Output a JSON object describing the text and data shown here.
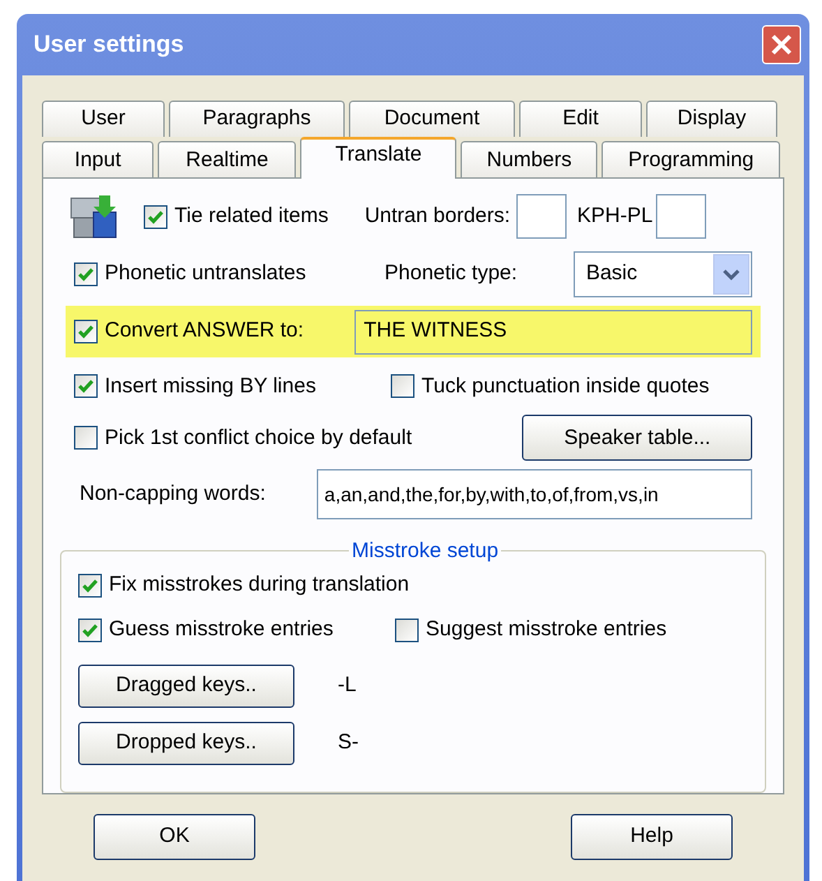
{
  "window": {
    "title": "User settings"
  },
  "tab_rows": [
    [
      {
        "label": "User",
        "selected": false
      },
      {
        "label": "Paragraphs",
        "selected": false
      },
      {
        "label": "Document",
        "selected": false
      },
      {
        "label": "Edit",
        "selected": false
      },
      {
        "label": "Display",
        "selected": false
      }
    ],
    [
      {
        "label": "Input",
        "selected": false
      },
      {
        "label": "Realtime",
        "selected": false
      },
      {
        "label": "Translate",
        "selected": true
      },
      {
        "label": "Numbers",
        "selected": false
      },
      {
        "label": "Programming",
        "selected": false
      }
    ]
  ],
  "tie_related_items": {
    "label": "Tie related items",
    "checked": true
  },
  "untran_borders": {
    "label": "Untran borders:"
  },
  "kph_pl": {
    "label": "KPH-PL"
  },
  "phonetic_untranslates": {
    "label": "Phonetic untranslates",
    "checked": true
  },
  "phonetic_type": {
    "label": "Phonetic type:",
    "value": "Basic"
  },
  "convert_answer": {
    "label": "Convert ANSWER to:",
    "checked": true,
    "value": "THE WITNESS",
    "highlighted": true
  },
  "insert_missing_by_lines": {
    "label": "Insert missing BY lines",
    "checked": true
  },
  "tuck_punctuation": {
    "label": "Tuck punctuation inside quotes",
    "checked": false
  },
  "pick_first_conflict": {
    "label": "Pick 1st conflict choice by default",
    "checked": false
  },
  "speaker_table_button": "Speaker table...",
  "non_capping_words": {
    "label": "Non-capping words:",
    "value": "a,an,and,the,for,by,with,to,of,from,vs,in"
  },
  "misstroke_setup": {
    "title": "Misstroke setup",
    "fix_misstrokes": {
      "label": "Fix misstrokes during translation",
      "checked": true
    },
    "guess_misstroke": {
      "label": "Guess misstroke entries",
      "checked": true
    },
    "suggest_misstroke": {
      "label": "Suggest misstroke entries",
      "checked": false
    },
    "dragged_keys": {
      "button": "Dragged keys..",
      "value": "-L"
    },
    "dropped_keys": {
      "button": "Dropped keys..",
      "value": "S-"
    }
  },
  "buttons": [
    "OK",
    "Help"
  ]
}
